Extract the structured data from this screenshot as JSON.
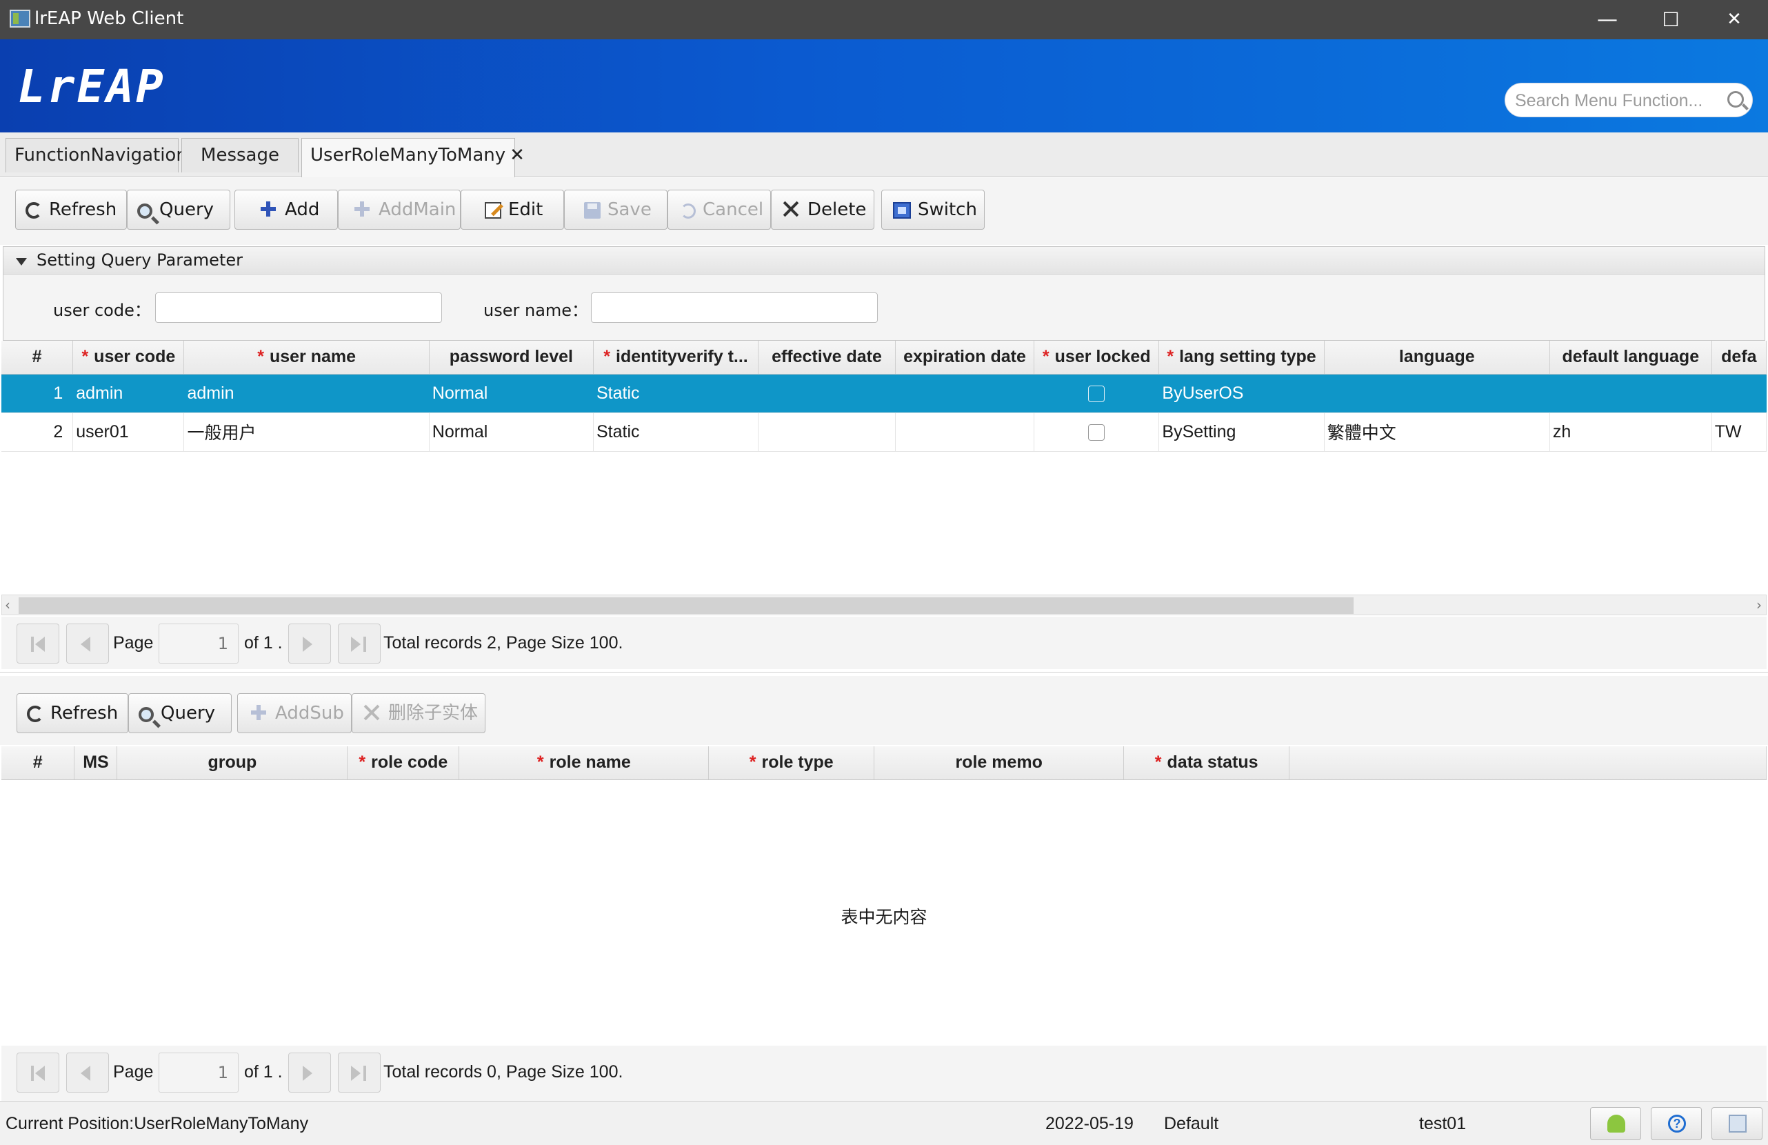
{
  "window": {
    "title": "lrEAP Web Client",
    "minimize": "—",
    "maximize": "☐",
    "close": "✕"
  },
  "header": {
    "logo": "LrEAP",
    "search_placeholder": "Search Menu Function..."
  },
  "tabs": [
    {
      "label": "FunctionNavigation"
    },
    {
      "label": "Message"
    },
    {
      "label": "UserRoleManyToMany",
      "close": "✕"
    }
  ],
  "main_toolbar": {
    "refresh": "Refresh",
    "query": "Query",
    "add": "Add",
    "addmain": "AddMain",
    "edit": "Edit",
    "save": "Save",
    "cancel": "Cancel",
    "delete": "Delete",
    "switch": "Switch"
  },
  "query_panel": {
    "title": "Setting Query Parameter",
    "user_code_label": "user code：",
    "user_code_value": "",
    "user_name_label": "user name：",
    "user_name_value": ""
  },
  "user_grid": {
    "columns": [
      {
        "label": "#",
        "req": ""
      },
      {
        "label": "user code",
        "req": "*"
      },
      {
        "label": "user name",
        "req": "*"
      },
      {
        "label": "password level",
        "req": ""
      },
      {
        "label": "identityverify t...",
        "req": "*"
      },
      {
        "label": "effective date",
        "req": ""
      },
      {
        "label": "expiration date",
        "req": ""
      },
      {
        "label": "user locked",
        "req": "*"
      },
      {
        "label": "lang setting type",
        "req": "*"
      },
      {
        "label": "language",
        "req": ""
      },
      {
        "label": "default language",
        "req": ""
      },
      {
        "label": "defa",
        "req": ""
      }
    ],
    "rows": [
      {
        "n": "1",
        "code": "admin",
        "name": "admin",
        "pwd": "Normal",
        "idv": "Static",
        "eff": "",
        "exp": "",
        "locked": false,
        "lang_type": "ByUserOS",
        "language": "",
        "def_lang": "",
        "defa": ""
      },
      {
        "n": "2",
        "code": "user01",
        "name": "一般用户",
        "pwd": "Normal",
        "idv": "Static",
        "eff": "",
        "exp": "",
        "locked": false,
        "lang_type": "BySetting",
        "language": "繁體中文",
        "def_lang": "zh",
        "defa": "TW"
      }
    ]
  },
  "pager_top": {
    "page_label": "Page",
    "page_value": "1",
    "of_label": "of 1 .",
    "summary": "Total records  2, Page Size 100."
  },
  "sub_toolbar": {
    "refresh": "Refresh",
    "query": "Query",
    "addsub": "AddSub",
    "delete_sub": "删除子实体"
  },
  "role_grid": {
    "columns": [
      {
        "label": "#",
        "req": ""
      },
      {
        "label": "MS",
        "req": ""
      },
      {
        "label": "group",
        "req": ""
      },
      {
        "label": "role code",
        "req": "*"
      },
      {
        "label": "role name",
        "req": "*"
      },
      {
        "label": "role type",
        "req": "*"
      },
      {
        "label": "role memo",
        "req": ""
      },
      {
        "label": "data status",
        "req": "*"
      }
    ],
    "empty_text": "表中无内容"
  },
  "pager_bottom": {
    "page_label": "Page",
    "page_value": "1",
    "of_label": "of 1 .",
    "summary": "Total records  0, Page Size 100."
  },
  "status": {
    "position": "Current Position:UserRoleManyToMany",
    "date": "2022-05-19",
    "profile": "Default",
    "user": "test01"
  },
  "colors": {
    "header_start": "#0a3fb0",
    "header_end": "#0b79e0",
    "selected_row": "#0f96c8",
    "required_mark": "#dd2222"
  },
  "icons": {
    "refresh": "refresh-icon",
    "query": "magnifier-icon",
    "add": "plus-icon",
    "edit": "edit-icon",
    "save": "save-icon",
    "cancel": "undo-icon",
    "delete": "x-icon",
    "switch": "switch-icon",
    "status_user": "user-icon",
    "status_help": "help-icon",
    "status_note": "note-icon"
  }
}
